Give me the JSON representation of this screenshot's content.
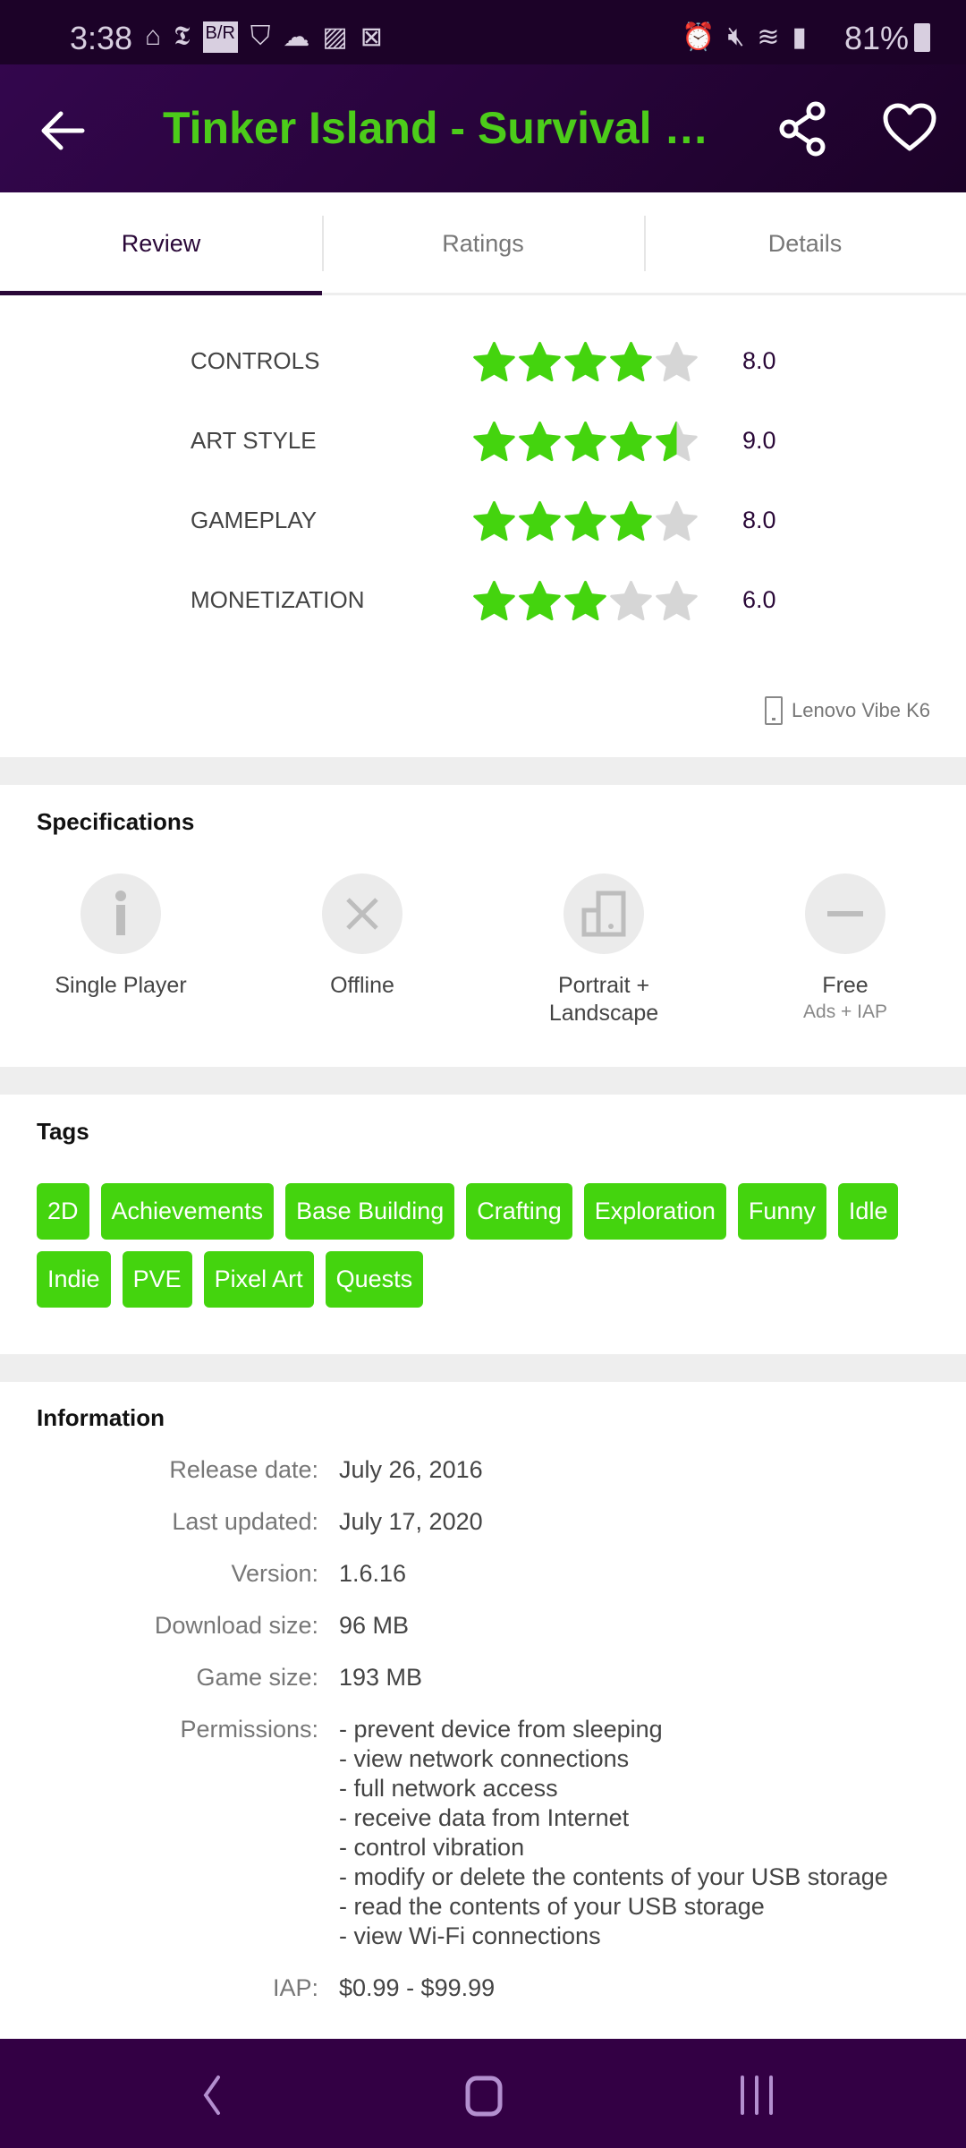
{
  "status_bar": {
    "time": "3:38",
    "battery": "81%",
    "notification_icons": [
      "home-icon",
      "nyt-icon",
      "br-icon",
      "pocket-icon",
      "weather-icon",
      "image-icon",
      "file-x-icon"
    ],
    "system_icons": [
      "alarm-icon",
      "mute-icon",
      "wifi-icon",
      "signal-icon"
    ]
  },
  "app_bar": {
    "title": "Tinker Island - Survival Story Adventure",
    "colors": {
      "title": "#4ccc1a",
      "background": "#1c0228"
    }
  },
  "tabs": [
    {
      "label": "Review",
      "active": true
    },
    {
      "label": "Ratings",
      "active": false
    },
    {
      "label": "Details",
      "active": false
    }
  ],
  "review": {
    "max_stars": 5,
    "ratings": [
      {
        "label": "CONTROLS",
        "value": "8.0",
        "stars": 4
      },
      {
        "label": "ART STYLE",
        "value": "9.0",
        "stars": 4.5
      },
      {
        "label": "GAMEPLAY",
        "value": "8.0",
        "stars": 4
      },
      {
        "label": "MONETIZATION",
        "value": "6.0",
        "stars": 3
      }
    ],
    "device": "Lenovo Vibe K6",
    "star_colors": {
      "filled": "#44d40e",
      "empty": "#d6d6d6"
    }
  },
  "specifications": {
    "title": "Specifications",
    "items": [
      {
        "label": "Single Player",
        "icon": "single-player-icon"
      },
      {
        "label": "Offline",
        "icon": "offline-icon"
      },
      {
        "label": "Portrait +\nLandscape",
        "icon": "orientation-icon"
      },
      {
        "label": "Free",
        "sub": "Ads + IAP",
        "icon": "free-icon"
      }
    ]
  },
  "tags": {
    "title": "Tags",
    "items": [
      "2D",
      "Achievements",
      "Base Building",
      "Crafting",
      "Exploration",
      "Funny",
      "Idle",
      "Indie",
      "PVE",
      "Pixel Art",
      "Quests"
    ]
  },
  "information": {
    "title": "Information",
    "rows": [
      {
        "key": "Release date:",
        "value": "July 26, 2016"
      },
      {
        "key": "Last updated:",
        "value": "July 17, 2020"
      },
      {
        "key": "Version:",
        "value": "1.6.16"
      },
      {
        "key": "Download size:",
        "value": "96 MB"
      },
      {
        "key": "Game size:",
        "value": "193 MB"
      },
      {
        "key": "Permissions:",
        "value": "- prevent device from sleeping\n- view network connections\n- full network access\n- receive data from Internet\n- control vibration\n- modify or delete the contents of your USB storage\n- read the contents of your USB storage\n- view Wi-Fi connections"
      },
      {
        "key": "IAP:",
        "value": "$0.99 - $99.99"
      }
    ]
  }
}
